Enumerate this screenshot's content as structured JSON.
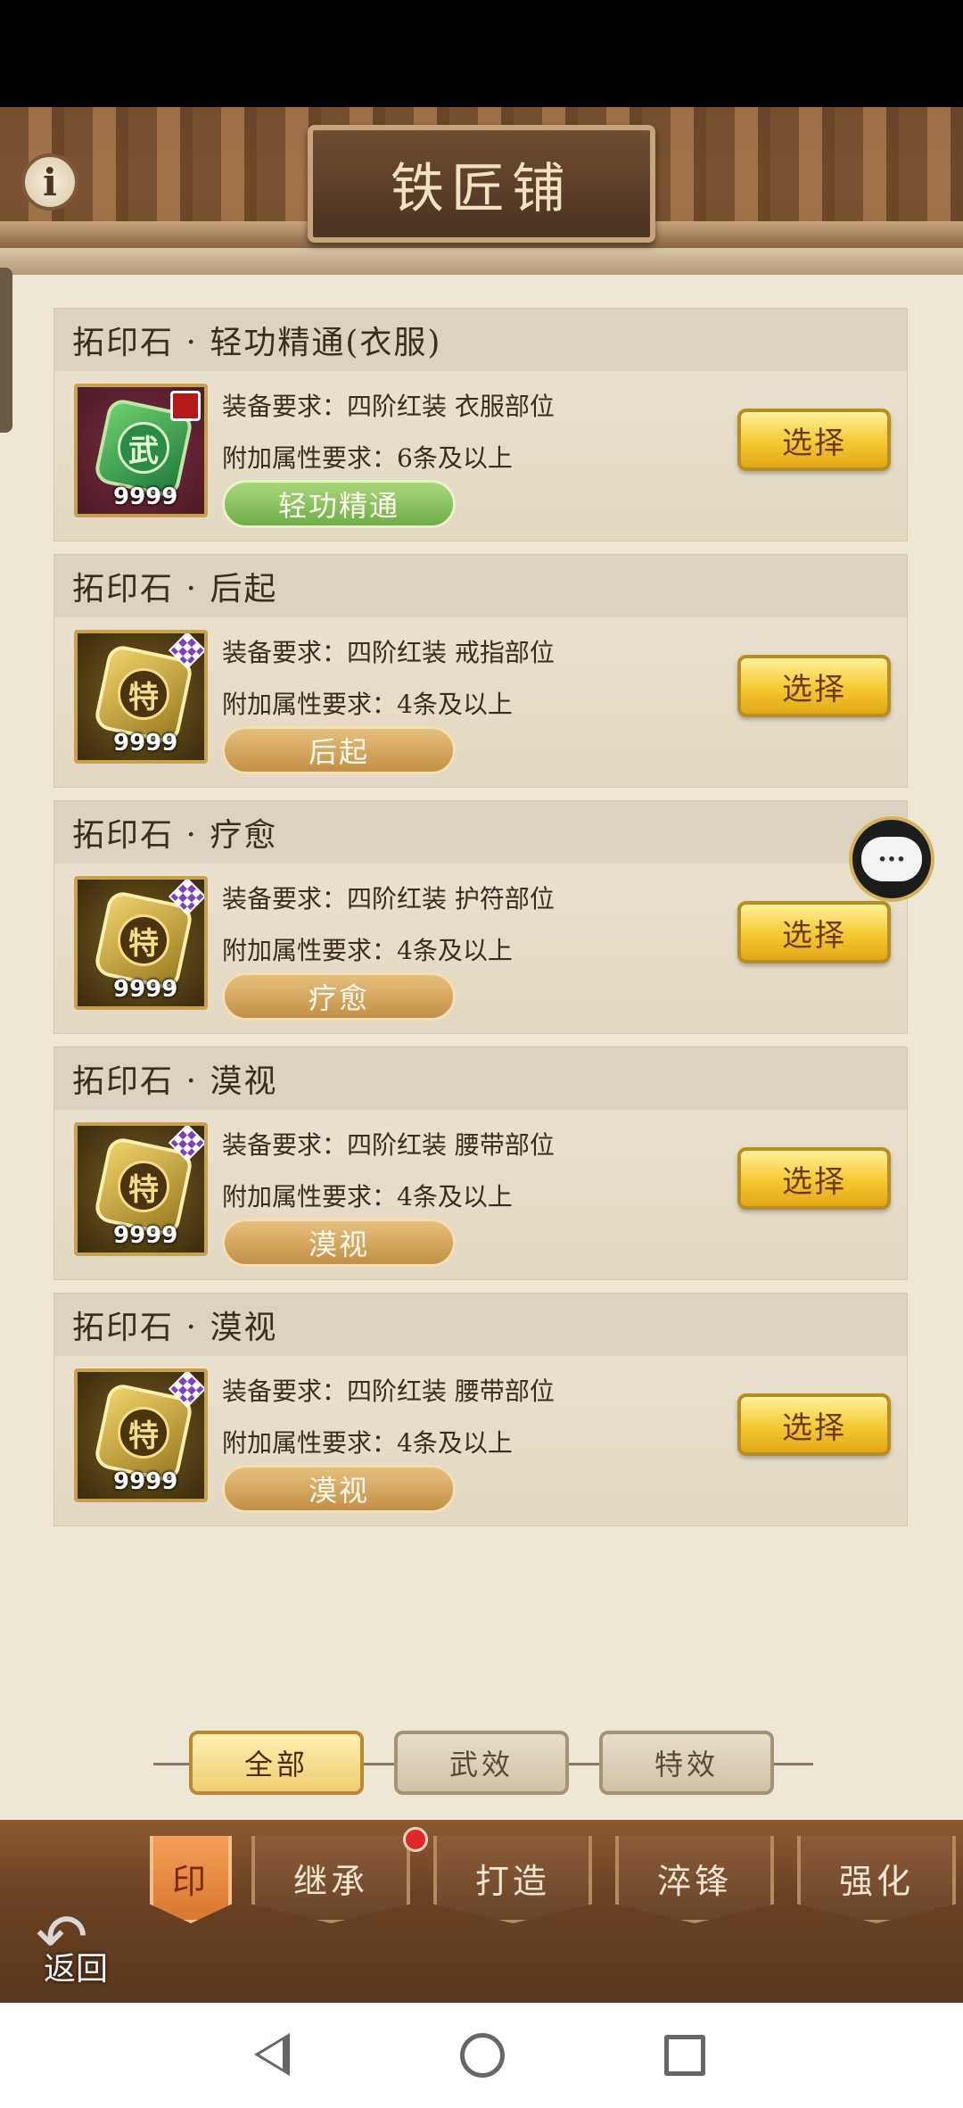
{
  "header": {
    "title": "铁匠铺",
    "info_icon": "i"
  },
  "items": [
    {
      "title": "拓印石 · 轻功精通(衣服)",
      "req_equip": "装备要求：四阶红装  衣服部位",
      "req_attr": "附加属性要求：6条及以上",
      "tag": "轻功精通",
      "count": "9999",
      "gem_char": "武",
      "style": "green",
      "select_label": "选择"
    },
    {
      "title": "拓印石 · 后起",
      "req_equip": "装备要求：四阶红装  戒指部位",
      "req_attr": "附加属性要求：4条及以上",
      "tag": "后起",
      "count": "9999",
      "gem_char": "特",
      "style": "gold",
      "select_label": "选择"
    },
    {
      "title": "拓印石 · 疗愈",
      "req_equip": "装备要求：四阶红装  护符部位",
      "req_attr": "附加属性要求：4条及以上",
      "tag": "疗愈",
      "count": "9999",
      "gem_char": "特",
      "style": "gold",
      "select_label": "选择"
    },
    {
      "title": "拓印石 · 漠视",
      "req_equip": "装备要求：四阶红装  腰带部位",
      "req_attr": "附加属性要求：4条及以上",
      "tag": "漠视",
      "count": "9999",
      "gem_char": "特",
      "style": "gold",
      "select_label": "选择"
    },
    {
      "title": "拓印石 · 漠视",
      "req_equip": "装备要求：四阶红装  腰带部位",
      "req_attr": "附加属性要求：4条及以上",
      "tag": "漠视",
      "count": "9999",
      "gem_char": "特",
      "style": "gold",
      "select_label": "选择"
    }
  ],
  "chat": {
    "icon": "chat-bubble-icon",
    "glyph": "···"
  },
  "filters": [
    {
      "label": "全部",
      "active": true
    },
    {
      "label": "武效",
      "active": false
    },
    {
      "label": "特效",
      "active": false
    }
  ],
  "bottom_nav": {
    "back_label": "返回",
    "tabs": [
      {
        "label": "印",
        "active": true
      },
      {
        "label": "继承",
        "active": false
      },
      {
        "label": "打造",
        "active": false
      },
      {
        "label": "淬锋",
        "active": false
      },
      {
        "label": "强化",
        "active": false
      }
    ]
  },
  "colors": {
    "accent_gold": "#f5c830",
    "panel_bg": "#efe7d6",
    "active_tab": "#d9772f"
  }
}
